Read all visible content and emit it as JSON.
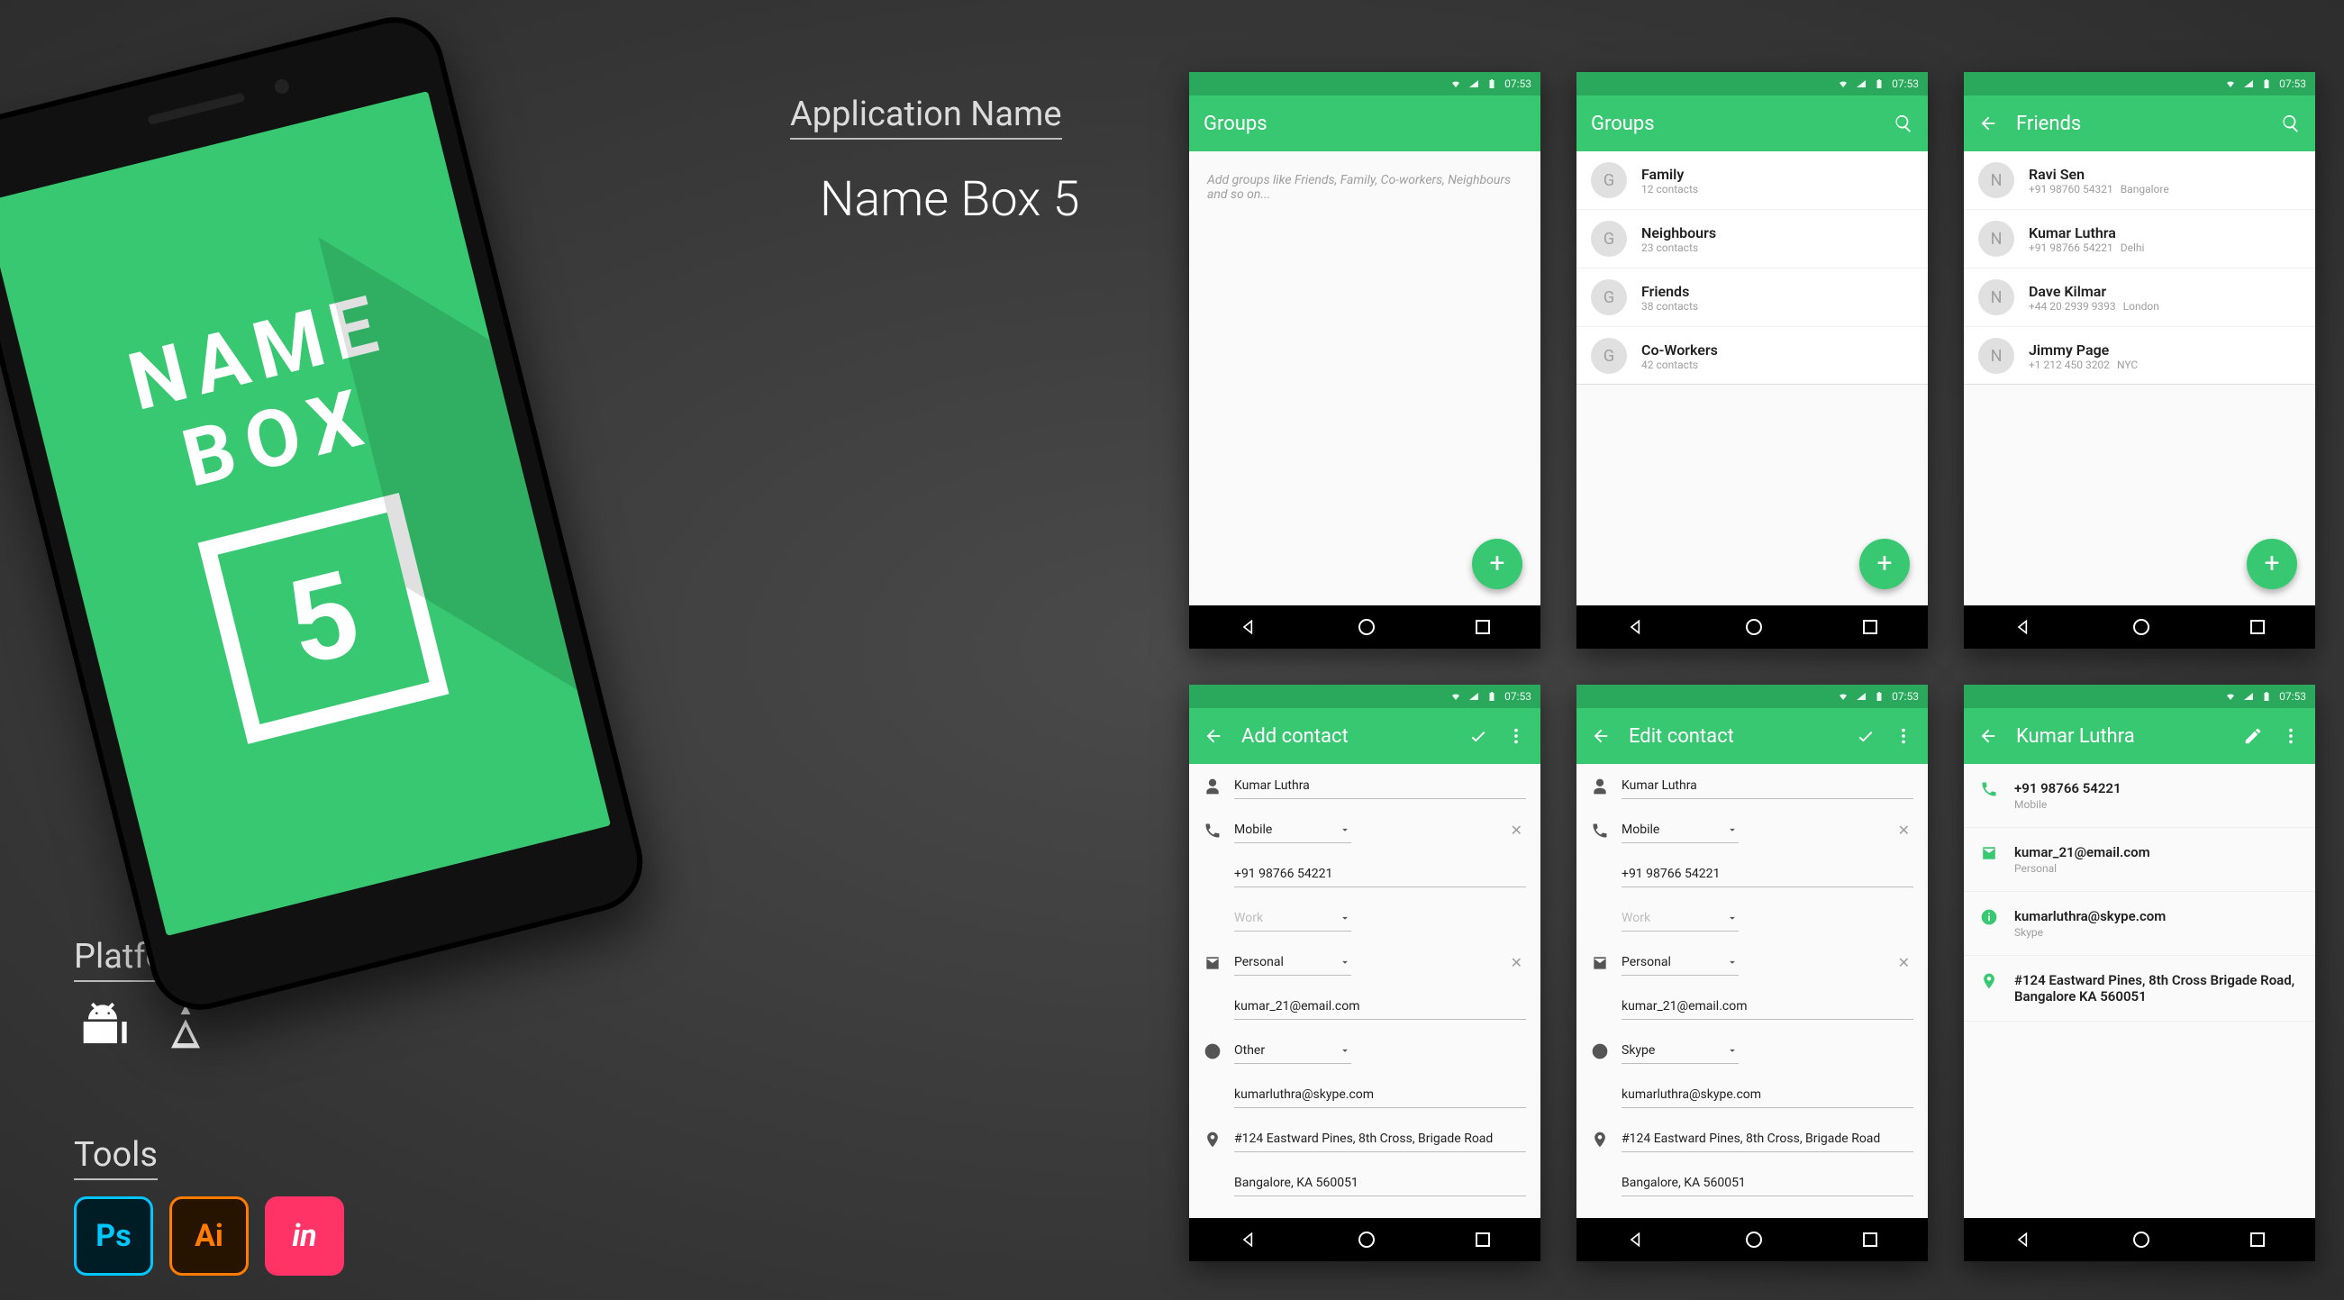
{
  "hero": {
    "label": "Application Name",
    "name": "Name Box 5",
    "logo_line1": "NAME",
    "logo_line2": "BOX",
    "logo_digit": "5"
  },
  "platform_label": "Platform",
  "tools_label": "Tools",
  "tools": {
    "ps": "Ps",
    "ai": "Ai",
    "in": "in"
  },
  "status_time": "07:53",
  "fab_plus": "+",
  "screen_groups_empty": {
    "title": "Groups",
    "hint": "Add groups like Friends, Family, Co-workers, Neighbours and so on..."
  },
  "screen_groups": {
    "title": "Groups",
    "items": [
      {
        "initial": "G",
        "name": "Family",
        "sub": "12 contacts"
      },
      {
        "initial": "G",
        "name": "Neighbours",
        "sub": "23 contacts"
      },
      {
        "initial": "G",
        "name": "Friends",
        "sub": "38 contacts"
      },
      {
        "initial": "G",
        "name": "Co-Workers",
        "sub": "42 contacts"
      }
    ]
  },
  "screen_friends": {
    "title": "Friends",
    "items": [
      {
        "initial": "N",
        "name": "Ravi Sen",
        "phone": "+91 98760 54321",
        "loc": "Bangalore"
      },
      {
        "initial": "N",
        "name": "Kumar Luthra",
        "phone": "+91 98766 54221",
        "loc": "Delhi"
      },
      {
        "initial": "N",
        "name": "Dave Kilmar",
        "phone": "+44 20 2939 9393",
        "loc": "London"
      },
      {
        "initial": "N",
        "name": "Jimmy Page",
        "phone": "+1 212 450 3202",
        "loc": "NYC"
      }
    ]
  },
  "screen_add": {
    "title": "Add contact",
    "name_value": "Kumar Luthra",
    "phone_type": "Mobile",
    "phone_value": "+91 98766 54221",
    "phone_type2": "Work",
    "email_type": "Personal",
    "email_value": "kumar_21@email.com",
    "im_type": "Other",
    "im_value": "kumarluthra@skype.com",
    "address1": "#124 Eastward Pines, 8th Cross, Brigade Road",
    "address2": "Bangalore, KA 560051"
  },
  "screen_edit": {
    "title": "Edit contact",
    "name_value": "Kumar Luthra",
    "phone_type": "Mobile",
    "phone_value": "+91 98766 54221",
    "phone_type2": "Work",
    "email_type": "Personal",
    "email_value": "kumar_21@email.com",
    "im_type": "Skype",
    "im_value": "kumarluthra@skype.com",
    "address1": "#124 Eastward Pines, 8th Cross, Brigade Road",
    "address2": "Bangalore, KA 560051"
  },
  "screen_detail": {
    "title": "Kumar Luthra",
    "phone": "+91 98766 54221",
    "phone_label": "Mobile",
    "email": "kumar_21@email.com",
    "email_label": "Personal",
    "im": "kumarluthra@skype.com",
    "im_label": "Skype",
    "address": "#124 Eastward Pines, 8th Cross Brigade Road, Bangalore KA 560051"
  }
}
